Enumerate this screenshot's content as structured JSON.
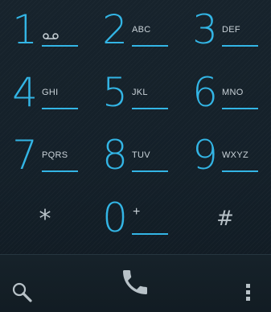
{
  "keypad": {
    "keys": [
      {
        "digit": "1",
        "letters": "",
        "icon": "voicemail-icon"
      },
      {
        "digit": "2",
        "letters": "ABC"
      },
      {
        "digit": "3",
        "letters": "DEF"
      },
      {
        "digit": "4",
        "letters": "GHI"
      },
      {
        "digit": "5",
        "letters": "JKL"
      },
      {
        "digit": "6",
        "letters": "MNO"
      },
      {
        "digit": "7",
        "letters": "PQRS"
      },
      {
        "digit": "8",
        "letters": "TUV"
      },
      {
        "digit": "9",
        "letters": "WXYZ"
      },
      {
        "symbol": "*"
      },
      {
        "digit": "0",
        "letters": "+"
      },
      {
        "symbol": "#"
      }
    ]
  },
  "bottom_bar": {
    "search_icon": "search-icon",
    "call_icon": "phone-handset-icon",
    "menu_icon": "overflow-menu-icon"
  },
  "colors": {
    "accent": "#33b5e5",
    "background": "#142029",
    "secondary_text": "#c9d2d8",
    "icon_grey": "#b8c2c8"
  }
}
